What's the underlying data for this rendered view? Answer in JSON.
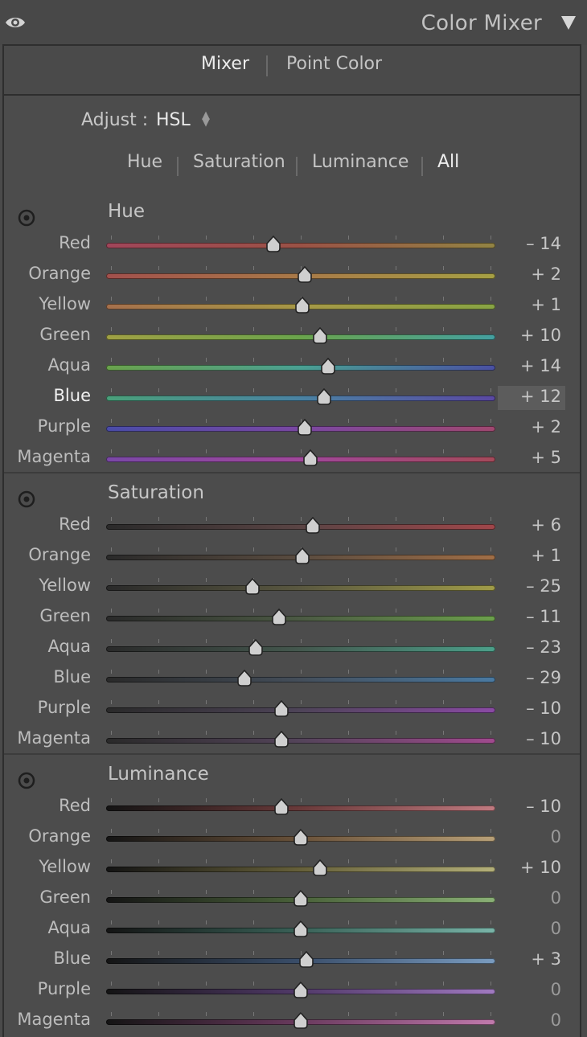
{
  "header": {
    "title": "Color Mixer"
  },
  "modes": [
    {
      "label": "Mixer",
      "active": true
    },
    {
      "label": "Point Color",
      "active": false
    }
  ],
  "adjust": {
    "label": "Adjust :",
    "value": "HSL"
  },
  "tabs": [
    {
      "label": "Hue",
      "active": false
    },
    {
      "label": "Saturation",
      "active": false
    },
    {
      "label": "Luminance",
      "active": false
    },
    {
      "label": "All",
      "active": true
    }
  ],
  "sections": [
    {
      "key": "hue",
      "title": "Hue",
      "rows": [
        {
          "label": "Red",
          "value": -14,
          "display": "– 14",
          "gradient": [
            "#a0465a",
            "#9a5246",
            "#928444"
          ]
        },
        {
          "label": "Orange",
          "value": 2,
          "display": "+ 2",
          "gradient": [
            "#a2504c",
            "#a87a48",
            "#a6a044"
          ]
        },
        {
          "label": "Yellow",
          "value": 1,
          "display": "+ 1",
          "gradient": [
            "#a6704c",
            "#a69846",
            "#88a444"
          ]
        },
        {
          "label": "Green",
          "value": 10,
          "display": "+ 10",
          "gradient": [
            "#a0a044",
            "#6aa44c",
            "#44a0a0"
          ]
        },
        {
          "label": "Aqua",
          "value": 14,
          "display": "+ 14",
          "gradient": [
            "#6aa24c",
            "#4aa092",
            "#4a50a2"
          ]
        },
        {
          "label": "Blue",
          "value": 12,
          "display": "+ 12",
          "gradient": [
            "#4aa07a",
            "#4a82a2",
            "#5a48a2"
          ],
          "selected": true
        },
        {
          "label": "Purple",
          "value": 2,
          "display": "+ 2",
          "gradient": [
            "#4a4ca8",
            "#7a48a2",
            "#a04870"
          ]
        },
        {
          "label": "Magenta",
          "value": 5,
          "display": "+ 5",
          "gradient": [
            "#7a48a6",
            "#a0489a",
            "#a44a5a"
          ]
        }
      ]
    },
    {
      "key": "saturation",
      "title": "Saturation",
      "rows": [
        {
          "label": "Red",
          "value": 6,
          "display": "+ 6",
          "gradient": [
            "#2a2a2a",
            "#5a4444",
            "#a0464a"
          ]
        },
        {
          "label": "Orange",
          "value": 1,
          "display": "+ 1",
          "gradient": [
            "#2a2a2a",
            "#5a4c40",
            "#a06e46"
          ]
        },
        {
          "label": "Yellow",
          "value": -25,
          "display": "– 25",
          "gradient": [
            "#2a2a2a",
            "#5a5840",
            "#a09c48"
          ]
        },
        {
          "label": "Green",
          "value": -11,
          "display": "– 11",
          "gradient": [
            "#2a2a2a",
            "#4c5a44",
            "#6ca04c"
          ]
        },
        {
          "label": "Aqua",
          "value": -23,
          "display": "– 23",
          "gradient": [
            "#2a2a2a",
            "#44584e",
            "#4ca08a"
          ]
        },
        {
          "label": "Blue",
          "value": -29,
          "display": "– 29",
          "gradient": [
            "#2a2a2a",
            "#444e5a",
            "#4a7aa2"
          ]
        },
        {
          "label": "Purple",
          "value": -10,
          "display": "– 10",
          "gradient": [
            "#2a2a2a",
            "#4e4458",
            "#8a4aa4"
          ]
        },
        {
          "label": "Magenta",
          "value": -10,
          "display": "– 10",
          "gradient": [
            "#2a2a2a",
            "#54445a",
            "#a04a8e"
          ]
        }
      ]
    },
    {
      "key": "luminance",
      "title": "Luminance",
      "rows": [
        {
          "label": "Red",
          "value": -10,
          "display": "– 10",
          "gradient": [
            "#141414",
            "#6a3a3a",
            "#c07a80"
          ]
        },
        {
          "label": "Orange",
          "value": 0,
          "display": "0",
          "gradient": [
            "#141414",
            "#6a523a",
            "#b8a078"
          ]
        },
        {
          "label": "Yellow",
          "value": 10,
          "display": "+ 10",
          "gradient": [
            "#141414",
            "#66603a",
            "#b4b07a"
          ]
        },
        {
          "label": "Green",
          "value": 0,
          "display": "0",
          "gradient": [
            "#141414",
            "#4a623a",
            "#8ab076"
          ]
        },
        {
          "label": "Aqua",
          "value": 0,
          "display": "0",
          "gradient": [
            "#141414",
            "#3a6258",
            "#7ab4a8"
          ]
        },
        {
          "label": "Blue",
          "value": 3,
          "display": "+ 3",
          "gradient": [
            "#141414",
            "#3a4e6a",
            "#7a9cc0"
          ]
        },
        {
          "label": "Purple",
          "value": 0,
          "display": "0",
          "gradient": [
            "#141414",
            "#523a6a",
            "#a07ac0"
          ]
        },
        {
          "label": "Magenta",
          "value": 0,
          "display": "0",
          "gradient": [
            "#141414",
            "#6a3a5e",
            "#c07aac"
          ]
        }
      ]
    }
  ]
}
